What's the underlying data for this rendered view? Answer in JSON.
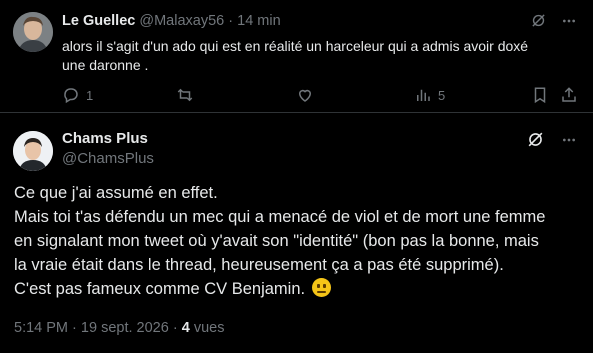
{
  "reply": {
    "name": "Le Guellec",
    "handle": "@Malaxay56",
    "separator": "·",
    "time": "14 min",
    "text": "alors il s'agit d'un ado qui est en réalité un harceleur qui a admis avoir doxé une daronne .",
    "replies": "1",
    "views": "5",
    "icons": [
      "grok-icon",
      "more-icon",
      "reply-icon",
      "retweet-icon",
      "like-icon",
      "views-icon",
      "bookmark-icon",
      "share-icon"
    ]
  },
  "main": {
    "name": "Chams Plus",
    "handle": "@ChamsPlus",
    "lines": [
      "Ce que j'ai assumé en effet.",
      "Mais toi t'as défendu un mec qui a menacé de viol et de mort une femme",
      "en signalant mon tweet où y'avait son \"identité\" (bon pas la bonne, mais",
      "la vraie était dans le thread, heureusement ça a pas été supprimé).",
      "C'est pas fameux comme CV Benjamin."
    ],
    "emoji": "neutral-face-emoji",
    "time": "5:14 PM",
    "date": "19 sept. 2026",
    "sep": "·",
    "views_count": "4",
    "views_label": "vues"
  },
  "colors": {
    "background": "#000000",
    "text": "#e7e9ea",
    "muted": "#71767b",
    "divider": "#2f3336"
  }
}
